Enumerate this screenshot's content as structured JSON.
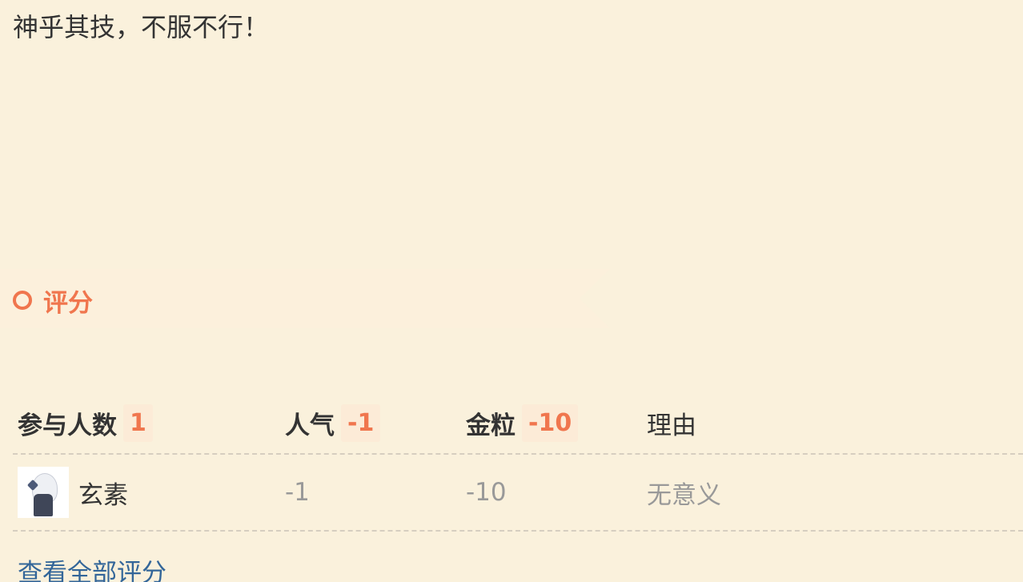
{
  "post": {
    "message": "神乎其技，不服不行！"
  },
  "rating": {
    "title": "评分",
    "accent_color": "#f0764e",
    "headers": {
      "participants_label": "参与人数",
      "participants_count": "1",
      "popularity_label": "人气",
      "popularity_total": "-1",
      "gold_label": "金粒",
      "gold_total": "-10",
      "reason_label": "理由"
    },
    "rows": [
      {
        "avatar_icon": "user-avatar",
        "username": "玄素",
        "popularity": "-1",
        "gold": "-10",
        "reason": "无意义"
      }
    ],
    "view_all_label": "查看全部评分"
  }
}
